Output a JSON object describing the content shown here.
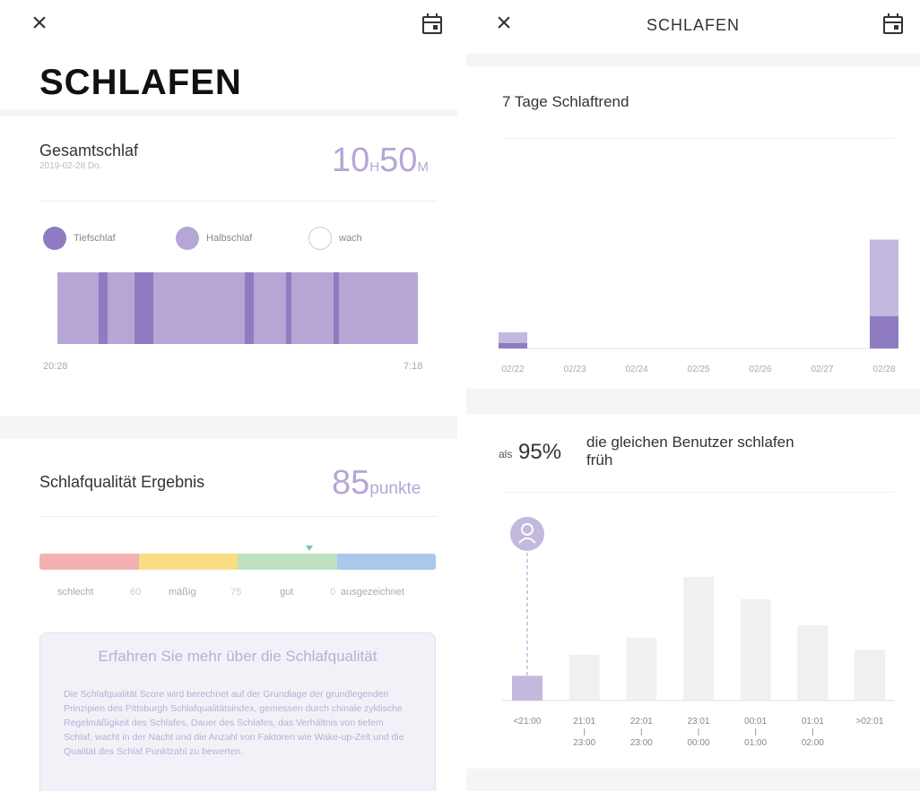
{
  "left": {
    "title": "SCHLAFEN",
    "total": {
      "label": "Gesamtschlaf",
      "date": "2019-02-28 Do.",
      "hours": "10",
      "h_unit": "H",
      "minutes": "50",
      "m_unit": "M"
    },
    "legend": [
      {
        "label": "Tiefschlaf",
        "color": "#8f7cc0"
      },
      {
        "label": "Halbschlaf",
        "color": "#b6a6d6"
      },
      {
        "label": "wach",
        "color": "#ffffff"
      }
    ],
    "timeline": {
      "start": "20:28",
      "end": "7:18",
      "deep_segments": [
        {
          "start": 0.115,
          "end": 0.14
        },
        {
          "start": 0.215,
          "end": 0.265
        },
        {
          "start": 0.52,
          "end": 0.545
        },
        {
          "start": 0.635,
          "end": 0.65
        },
        {
          "start": 0.765,
          "end": 0.78
        }
      ]
    },
    "quality": {
      "label": "Schlafqualität Ergebnis",
      "score": "85",
      "unit": "punkte",
      "marker_fraction": 0.68,
      "bands": [
        {
          "label": "schlecht",
          "color": "#f3b1b1"
        },
        {
          "label": "mäßig",
          "color": "#f8dc86"
        },
        {
          "label": "gut",
          "color": "#bfe0c0"
        },
        {
          "label": "ausgezeichnet",
          "color": "#a9c8ea"
        }
      ],
      "thresholds": [
        "60",
        "75",
        "0"
      ]
    },
    "info": {
      "title": "Erfahren Sie mehr über die Schlafqualität",
      "text": "Die Schlafqualität Score wird berechnet auf der Grundlage der grundlegenden Prinzipien des Pittsburgh Schlafqualitätsindex, gemessen durch chinale zyklische Regelmäßigkeit des Schlafes, Dauer des Schlafes, das Verhältnis von tiefem Schlaf, wacht in der Nacht und die Anzahl von Faktoren wie Wake-up-Zeit und die Qualität des Schlaf Punktzahl zu bewerten."
    }
  },
  "right": {
    "title": "SCHLAFEN",
    "trend_title": "7 Tage Schlaftrend",
    "compare": {
      "prefix": "als",
      "percent": "95%",
      "line1": "die gleichen Benutzer schlafen",
      "line2": "früh"
    }
  },
  "chart_data": [
    {
      "type": "bar",
      "title": "7 Tage Schlaftrend",
      "categories": [
        "02/22",
        "02/23",
        "02/24",
        "02/25",
        "02/26",
        "02/27",
        "02/28"
      ],
      "series": [
        {
          "values": [
            1.2,
            0,
            0,
            0,
            0,
            0,
            8.1
          ]
        },
        {
          "values": [
            0.4,
            0,
            0,
            0,
            0,
            0,
            2.4
          ]
        }
      ],
      "ylim": [
        0,
        10
      ],
      "colors": [
        "#c3b8de",
        "#8f7cc0"
      ]
    },
    {
      "type": "bar",
      "categories": [
        "<21:00",
        "21:01|23:00",
        "22:01|23:00",
        "23:01|00:00",
        "00:01|01:00",
        "01:01|02:00",
        ">02:01"
      ],
      "values": [
        20,
        37,
        51,
        100,
        82,
        61,
        41
      ],
      "highlight_index": 0,
      "ylim": [
        0,
        100
      ],
      "colors": [
        "#c3b8de",
        "#f0f0f2"
      ]
    }
  ]
}
